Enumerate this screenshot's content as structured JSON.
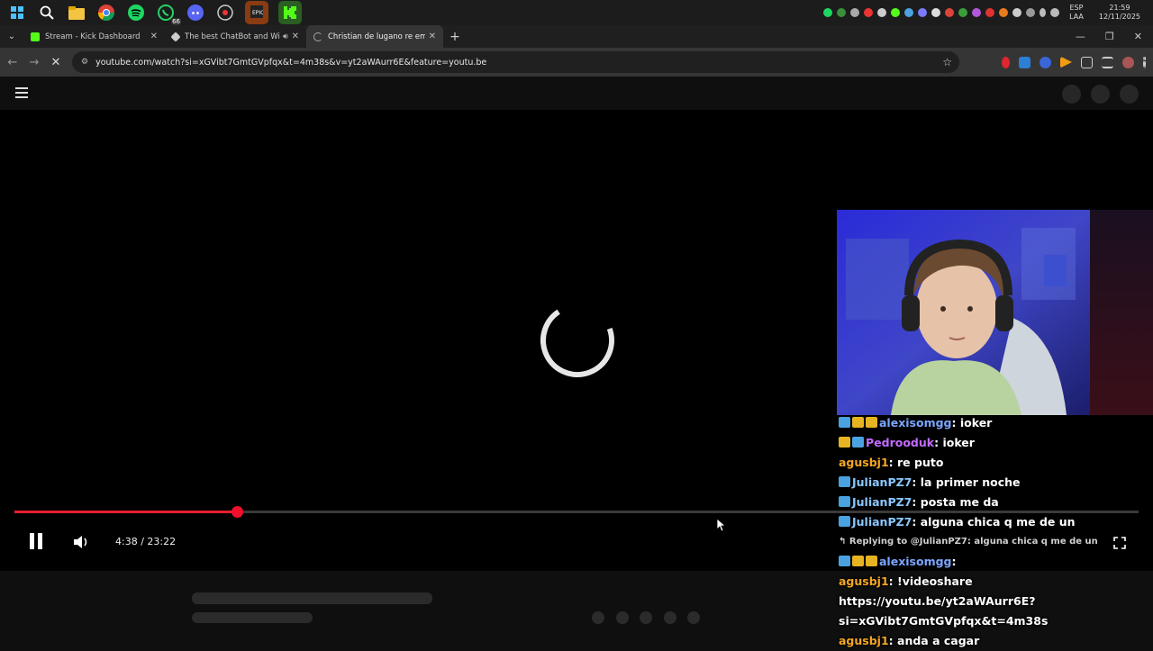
{
  "taskbar": {
    "icons": [
      "windows-start-icon",
      "search-icon",
      "file-explorer-icon",
      "chrome-icon",
      "spotify-icon",
      "whatsapp-icon",
      "discord-icon",
      "clock-app-icon",
      "epic-games-icon",
      "kick-icon"
    ],
    "whatsapp_badge": "66",
    "lang_top": "ESP",
    "lang_bottom": "LAA",
    "clock_time": "21:59",
    "clock_date": "12/11/2025"
  },
  "tabs": [
    {
      "title": "Stream - Kick Dashboard",
      "favicon_color": "#53fc18"
    },
    {
      "title": "The best ChatBot and Widg",
      "favicon_color": "#cccccc"
    },
    {
      "title": "Christian de lugano re empasta",
      "favicon_color": "#aaaaaa"
    }
  ],
  "new_tab_label": "+",
  "address": {
    "url": "youtube.com/watch?si=xGVibt7GmtGVpfqx&t=4m38s&v=yt2aWAurr6E&feature=youtu.be"
  },
  "player": {
    "time_display": "4:38 / 23:22",
    "progress_fraction": 0.198
  },
  "chat": {
    "messages": [
      {
        "user": "alexisomgg",
        "user_color": "#7ba6ff",
        "text": "ioker",
        "badges": [
          "#4aa3e0",
          "#e6b422",
          "#e6b422"
        ]
      },
      {
        "user": "Pedrooduk",
        "user_color": "#c36bff",
        "text": "ioker",
        "badges": [
          "#e6b422",
          "#4aa3e0"
        ]
      },
      {
        "user": "agusbj1",
        "user_color": "#f5a623",
        "text": "re puto",
        "badges": []
      },
      {
        "user": "JulianPZ7",
        "user_color": "#8ac7ff",
        "text": "la primer noche",
        "badges": [
          "#4aa3e0"
        ]
      },
      {
        "user": "JulianPZ7",
        "user_color": "#8ac7ff",
        "text": "posta me da",
        "badges": [
          "#4aa3e0"
        ]
      },
      {
        "user": "JulianPZ7",
        "user_color": "#8ac7ff",
        "text": "alguna chica q me de un",
        "badges": [
          "#4aa3e0"
        ]
      },
      {
        "reply": "Replying to @JulianPZ7: alguna chica q me de un"
      },
      {
        "user": "alexisomgg",
        "user_color": "#7ba6ff",
        "text": "",
        "badges": [
          "#4aa3e0",
          "#e6b422",
          "#e6b422"
        ]
      },
      {
        "user": "agusbj1",
        "user_color": "#f5a623",
        "text": "!videoshare",
        "badges": []
      },
      {
        "continuation": "https://youtu.be/yt2aWAurr6E?"
      },
      {
        "continuation": "si=xGVibt7GmtGVpfqx&t=4m38s"
      },
      {
        "user": "agusbj1",
        "user_color": "#f5a623",
        "text": "anda a cagar",
        "badges": []
      }
    ]
  }
}
